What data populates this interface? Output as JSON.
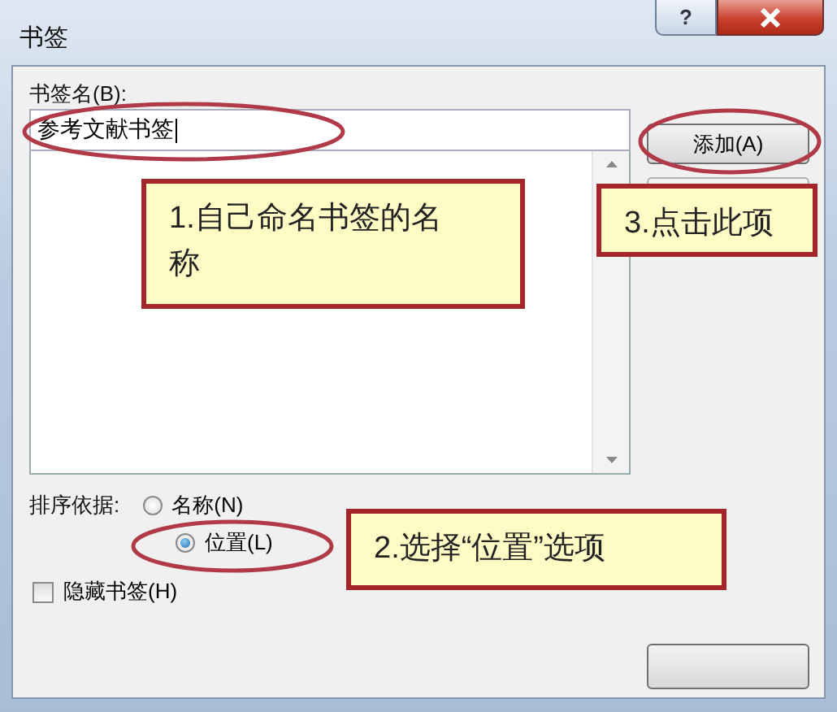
{
  "window": {
    "title": "书签",
    "help_label": "?"
  },
  "name_field": {
    "label": "书签名(B):",
    "value": "参考文献书签"
  },
  "add_button": {
    "label": "添加(A)"
  },
  "sort_by": {
    "label": "排序依据:",
    "options": [
      {
        "label": "名称(N)",
        "selected": false
      },
      {
        "label": "位置(L)",
        "selected": true
      }
    ]
  },
  "hidden_bookmarks": {
    "label": "隐藏书签(H)",
    "checked": false
  },
  "annotations": [
    {
      "text": "1.自己命名书签的名称"
    },
    {
      "text": "3.点击此项"
    },
    {
      "text": "2.选择“位置”选项"
    }
  ]
}
